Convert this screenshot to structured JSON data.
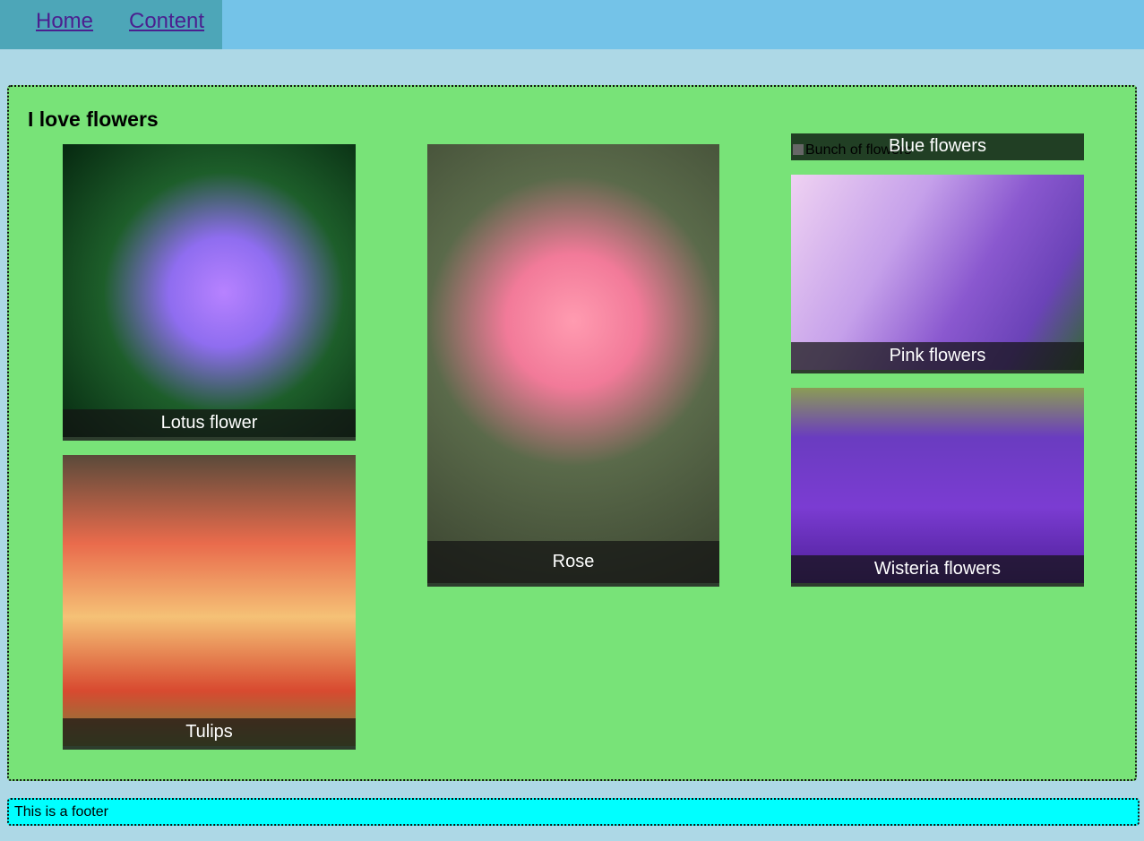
{
  "nav": {
    "links": [
      "Home",
      "Content"
    ]
  },
  "main": {
    "title": "I love flowers",
    "cards": {
      "lotus": "Lotus flower",
      "tulips": "Tulips",
      "rose": "Rose",
      "blue": "Blue flowers",
      "pink": "Pink flowers",
      "wisteria": "Wisteria flowers"
    },
    "blue_image_alt": "Bunch of flowers"
  },
  "footer": {
    "text": "This is a footer"
  }
}
